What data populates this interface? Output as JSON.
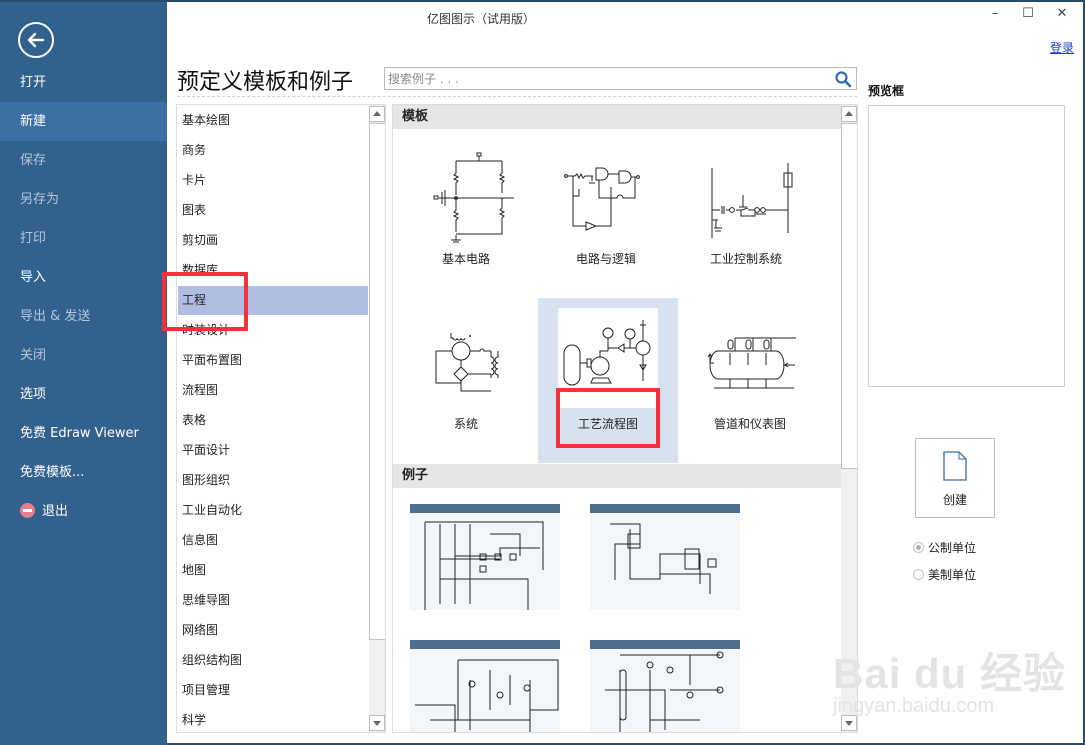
{
  "window": {
    "title": "亿图图示（试用版）",
    "controls": {
      "minimize": "–",
      "maximize": "☐",
      "close": "✕"
    },
    "login_link": "登录"
  },
  "sidebar": {
    "back_icon": "arrow-left-circle-icon",
    "items": [
      {
        "label": "打开",
        "state": "normal"
      },
      {
        "label": "新建",
        "state": "active"
      },
      {
        "label": "保存",
        "state": "disabled"
      },
      {
        "label": "另存为",
        "state": "disabled"
      },
      {
        "label": "打印",
        "state": "disabled"
      },
      {
        "label": "导入",
        "state": "normal"
      },
      {
        "label": "导出 & 发送",
        "state": "disabled"
      },
      {
        "label": "关闭",
        "state": "disabled"
      },
      {
        "label": "选项",
        "state": "normal"
      },
      {
        "label": "免费 Edraw Viewer",
        "state": "normal"
      },
      {
        "label": "免费模板...",
        "state": "normal"
      },
      {
        "label": "退出",
        "state": "normal",
        "icon": "minus-circle-icon"
      }
    ]
  },
  "header": {
    "title": "预定义模板和例子",
    "search": {
      "placeholder": "搜索例子 . . .",
      "value": ""
    }
  },
  "categories": {
    "selected": "工程",
    "items": [
      "基本绘图",
      "商务",
      "卡片",
      "图表",
      "剪切画",
      "数据库",
      "工程",
      "时装设计",
      "平面布置图",
      "流程图",
      "表格",
      "平面设计",
      "图形组织",
      "工业自动化",
      "信息图",
      "地图",
      "思维导图",
      "网络图",
      "组织结构图",
      "项目管理",
      "科学"
    ]
  },
  "templates": {
    "section_label": "模板",
    "selected": "工艺流程图",
    "items": [
      {
        "label": "基本电路",
        "icon": "basic-circuit-icon"
      },
      {
        "label": "电路与逻辑",
        "icon": "logic-circuit-icon"
      },
      {
        "label": "工业控制系统",
        "icon": "industrial-control-icon"
      },
      {
        "label": "系统",
        "icon": "system-diagram-icon"
      },
      {
        "label": "工艺流程图",
        "icon": "process-flow-icon"
      },
      {
        "label": "管道和仪表图",
        "icon": "pid-diagram-icon"
      }
    ]
  },
  "examples": {
    "section_label": "例子",
    "items": [
      {
        "name": "example-1"
      },
      {
        "name": "example-2"
      },
      {
        "name": "example-3"
      },
      {
        "name": "example-4"
      }
    ]
  },
  "preview": {
    "label": "预览框",
    "create_label": "创建",
    "units": [
      {
        "label": "公制单位",
        "checked": true
      },
      {
        "label": "美制单位",
        "checked": false
      }
    ]
  },
  "colors": {
    "sidebar": "#33618e",
    "sidebar_active": "#3c70a5",
    "category_selected": "#aebde0",
    "template_selected": "#d7e2ef",
    "highlight": "#f5323c",
    "link": "#1a3ec8"
  },
  "watermark": {
    "brand": "Bai du 经验",
    "url": "jingyan.baidu.com"
  }
}
